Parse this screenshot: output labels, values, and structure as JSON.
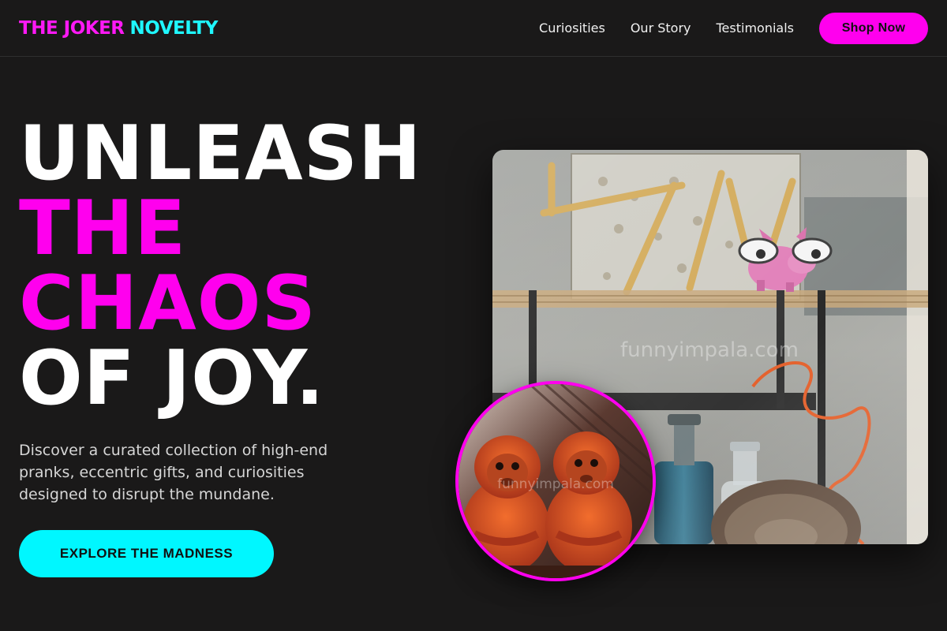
{
  "brand": {
    "part1": "THE JOKER",
    "part2": "NOVELTY"
  },
  "nav": {
    "items": [
      {
        "label": "Curiosities"
      },
      {
        "label": "Our Story"
      },
      {
        "label": "Testimonials"
      }
    ],
    "cta_label": "Shop Now"
  },
  "hero": {
    "title_lines": [
      "UNLEASH",
      "THE",
      "CHAOS",
      "OF JOY."
    ],
    "subtitle": "Discover a curated collection of high-end pranks, eccentric gifts, and curiosities designed to disrupt the mundane.",
    "cta_label": "EXPLORE THE MADNESS"
  },
  "images": {
    "shop_watermark": "funnyimpala.com",
    "circle_watermark": "funnyimpala.com"
  },
  "colors": {
    "background": "#1a1919",
    "magenta": "#ff00ee",
    "cyan": "#00f7ff",
    "text": "#ffffff"
  }
}
